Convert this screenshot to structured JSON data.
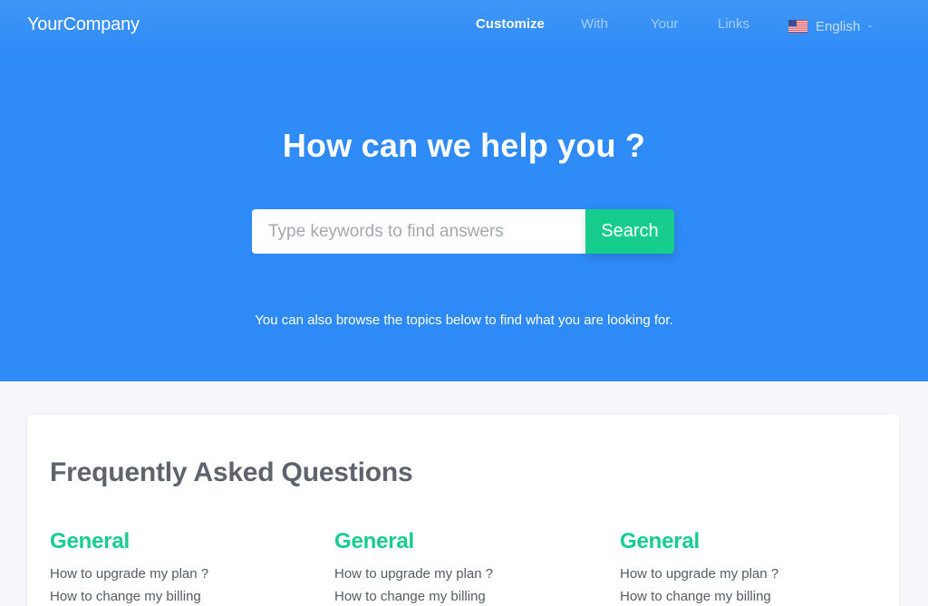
{
  "nav": {
    "logo": "YourCompany",
    "links": [
      "Customize",
      "With",
      "Your",
      "Links"
    ],
    "language": "English",
    "flag_icon": "us-flag-icon"
  },
  "hero": {
    "title": "How can we help you ?",
    "search": {
      "placeholder": "Type keywords to find answers",
      "value": "",
      "button_label": "Search"
    },
    "subtitle": "You can also browse the topics below to find what you are looking for."
  },
  "faq": {
    "title": "Frequently Asked Questions",
    "columns": [
      {
        "heading": "General",
        "questions": [
          "How to upgrade my plan ?",
          "How to change my billing"
        ]
      },
      {
        "heading": "General",
        "questions": [
          "How to upgrade my plan ?",
          "How to change my billing"
        ]
      },
      {
        "heading": "General",
        "questions": [
          "How to upgrade my plan ?",
          "How to change my billing"
        ]
      }
    ]
  },
  "colors": {
    "hero_blue": "#2e8af6",
    "accent_green": "#16cd8e",
    "heading_gray": "#5e646c",
    "page_bg": "#f6f7fb"
  }
}
